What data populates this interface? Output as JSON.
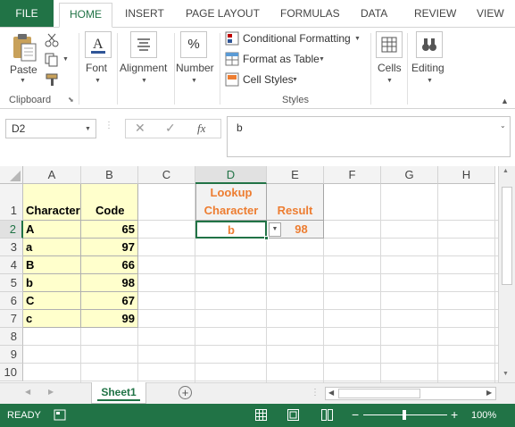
{
  "ribbon_tabs": [
    "FILE",
    "HOME",
    "INSERT",
    "PAGE LAYOUT",
    "FORMULAS",
    "DATA",
    "REVIEW",
    "VIEW"
  ],
  "clipboard": {
    "paste": "Paste",
    "group": "Clipboard"
  },
  "font": {
    "label": "Font"
  },
  "alignment": {
    "label": "Alignment"
  },
  "number": {
    "label": "Number"
  },
  "styles": {
    "conditional": "Conditional Formatting",
    "format_table": "Format as Table",
    "cell_styles": "Cell Styles",
    "group": "Styles"
  },
  "cells": {
    "label": "Cells"
  },
  "editing": {
    "label": "Editing"
  },
  "formula_bar": {
    "name_box": "D2",
    "fx": "fx",
    "value": "b"
  },
  "columns": [
    "A",
    "B",
    "C",
    "D",
    "E",
    "F",
    "G",
    "H"
  ],
  "rows": [
    "1",
    "2",
    "3",
    "4",
    "5",
    "6",
    "7",
    "8",
    "9",
    "10"
  ],
  "table": {
    "headers": [
      "Character",
      "Code"
    ],
    "rows": [
      [
        "A",
        "65"
      ],
      [
        "a",
        "97"
      ],
      [
        "B",
        "66"
      ],
      [
        "b",
        "98"
      ],
      [
        "C",
        "67"
      ],
      [
        "c",
        "99"
      ]
    ]
  },
  "lookup": {
    "header_line1": "Lookup",
    "header_line2": "Character",
    "result_header": "Result",
    "value": "b",
    "result": "98"
  },
  "sheet_tab": "Sheet1",
  "status": {
    "ready": "READY",
    "zoom": "100%"
  },
  "colors": {
    "accent": "#217346",
    "orange": "#ED7D31",
    "yellow": "#FFFFCC"
  }
}
